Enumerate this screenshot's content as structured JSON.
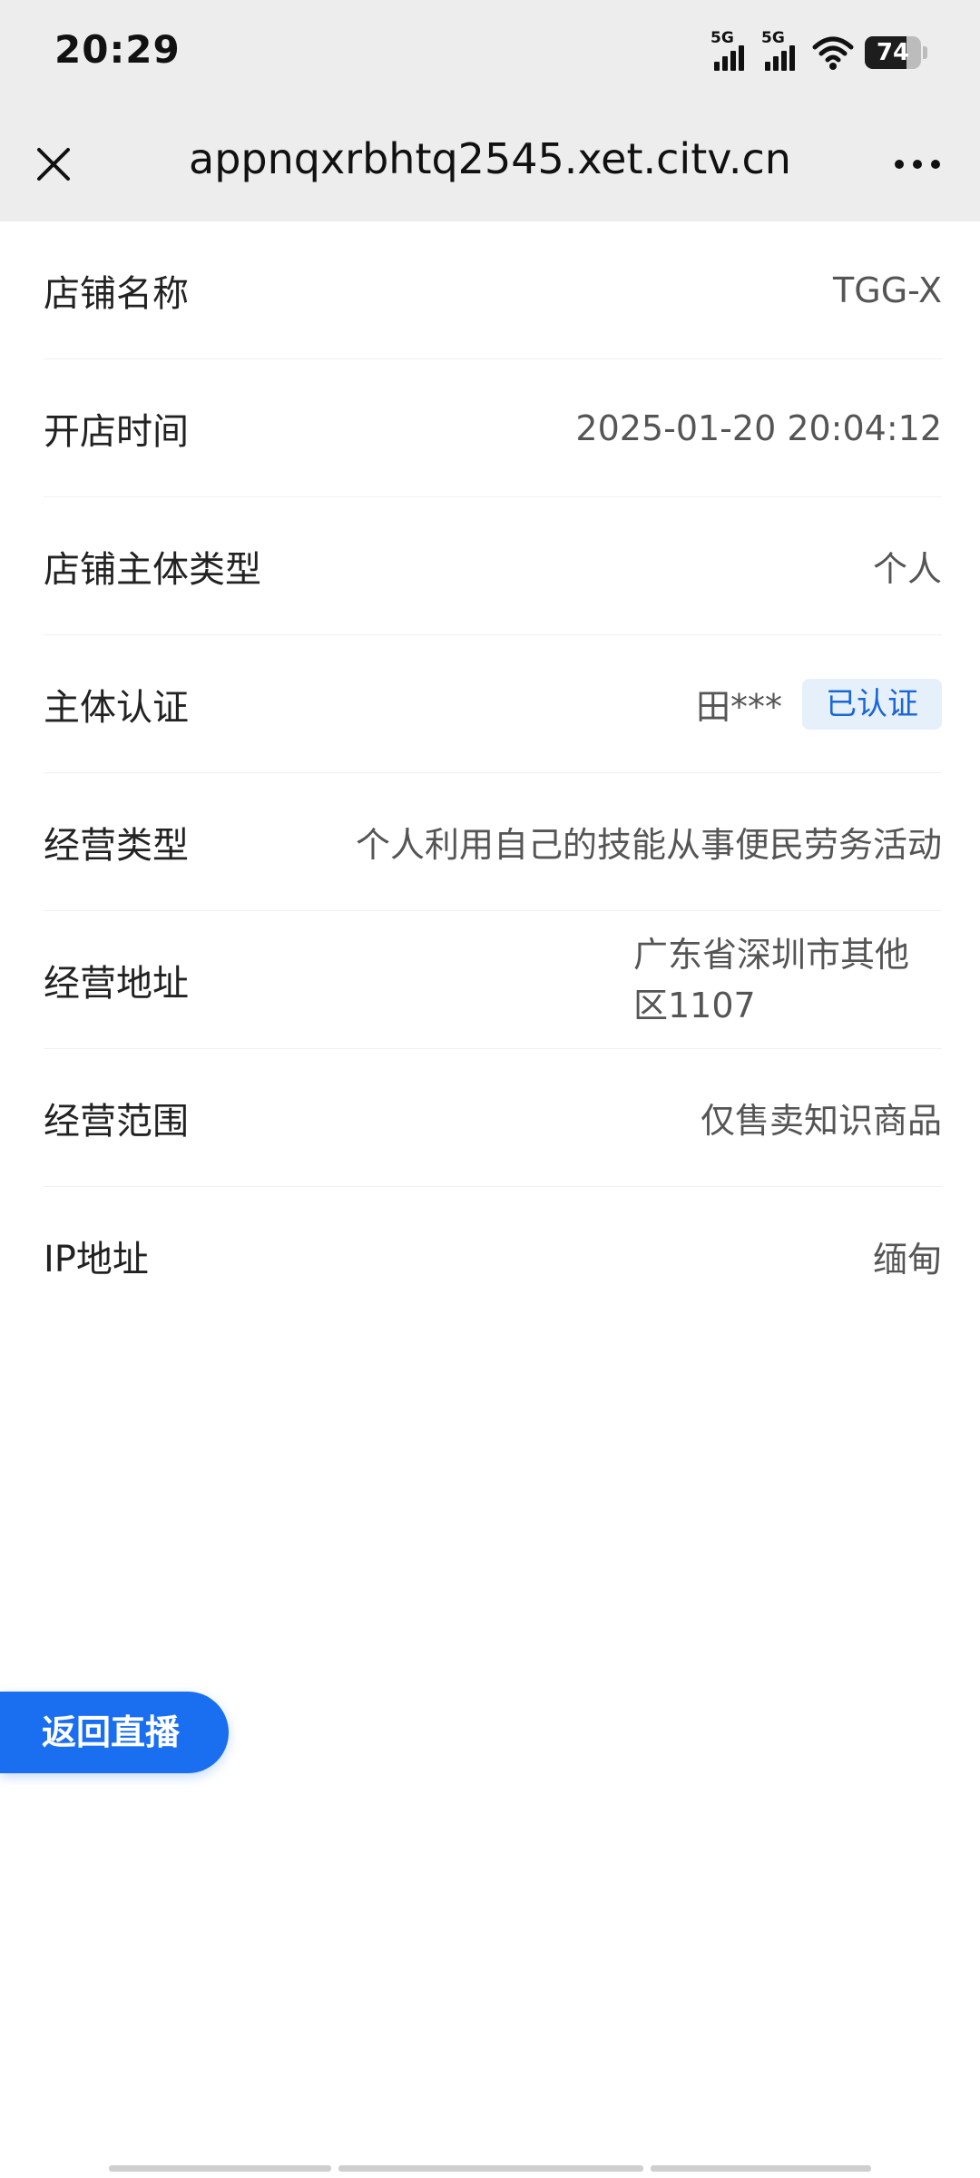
{
  "status_bar": {
    "time": "20:29",
    "signal_1": "5G",
    "signal_2": "5G",
    "battery": "74"
  },
  "nav": {
    "title": "appnqxrbhtq2545.xet.citv.cn"
  },
  "info": {
    "rows": [
      {
        "label": "店铺名称",
        "value": "TGG-X"
      },
      {
        "label": "开店时间",
        "value": "2025-01-20 20:04:12"
      },
      {
        "label": "店铺主体类型",
        "value": "个人"
      },
      {
        "label": "主体认证",
        "value": "田***",
        "badge": "已认证"
      },
      {
        "label": "经营类型",
        "value": "个人利用自己的技能从事便民劳务活动"
      },
      {
        "label": "经营地址",
        "value": "广东省深圳市其他区1107"
      },
      {
        "label": "经营范围",
        "value": "仅售卖知识商品"
      },
      {
        "label": "IP地址",
        "value": "缅甸"
      }
    ]
  },
  "back_live": {
    "label": "返回直播"
  },
  "colors": {
    "accent": "#1a6ef0",
    "badge_bg": "#e6f0fb",
    "badge_text": "#1a66d6",
    "header_bg": "#ededed"
  }
}
